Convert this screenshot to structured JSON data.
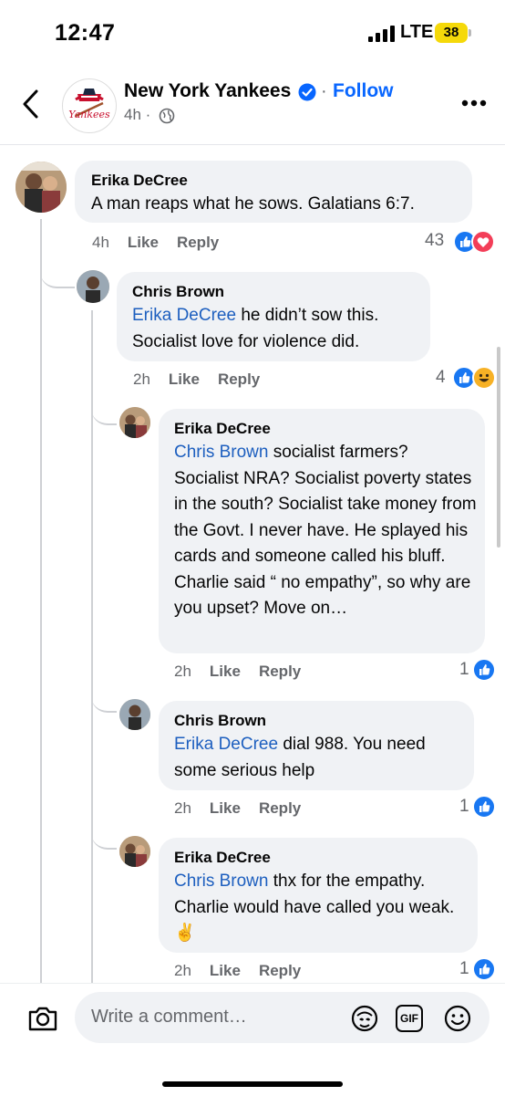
{
  "status_bar": {
    "time": "12:47",
    "network": "LTE",
    "battery": "38"
  },
  "header": {
    "page_name": "New York Yankees",
    "follow_label": "Follow",
    "separator": "·",
    "time_ago": "4h ·"
  },
  "comments": [
    {
      "author": "Erika DeCree",
      "mention": "",
      "text": "A man reaps what he sows. Galatians 6:7.",
      "time": "4h",
      "like": "Like",
      "reply": "Reply",
      "reactions": "43"
    },
    {
      "author": "Chris Brown",
      "mention": "Erika DeCree",
      "text": " he didn’t sow this. Socialist love for violence did.",
      "time": "2h",
      "like": "Like",
      "reply": "Reply",
      "reactions": "4"
    },
    {
      "author": "Erika DeCree",
      "mention": "Chris Brown",
      "text": " socialist farmers? Socialist NRA? Socialist poverty states in the south? Socialist take money from the Govt. I never have. He splayed his cards and someone called his bluff. Charlie said “ no empathy”, so why are you upset? Move on…",
      "time": "2h",
      "like": "Like",
      "reply": "Reply",
      "reactions": "1"
    },
    {
      "author": "Chris Brown",
      "mention": "Erika DeCree",
      "text": " dial 988. You need some serious help",
      "time": "2h",
      "like": "Like",
      "reply": "Reply",
      "reactions": "1"
    },
    {
      "author": "Erika DeCree",
      "mention": "Chris Brown",
      "text": " thx for the empathy. Charlie would have called you weak. ✌️",
      "time": "2h",
      "like": "Like",
      "reply": "Reply",
      "reactions": "1"
    }
  ],
  "composer": {
    "placeholder": "Write a comment…",
    "gif_label": "GIF"
  },
  "icons": [
    "back-icon",
    "verified-icon",
    "globe-icon",
    "more-icon",
    "like-reaction-icon",
    "love-reaction-icon",
    "haha-reaction-icon",
    "camera-icon",
    "avatar-sticker-icon",
    "gif-icon",
    "emoji-icon"
  ],
  "colors": {
    "accent": "#0866ff",
    "mention": "#1d5fbf",
    "bubble": "#f0f2f5",
    "like_blue": "#1877f2",
    "love_red": "#f33e58",
    "battery": "#f5d90a"
  }
}
